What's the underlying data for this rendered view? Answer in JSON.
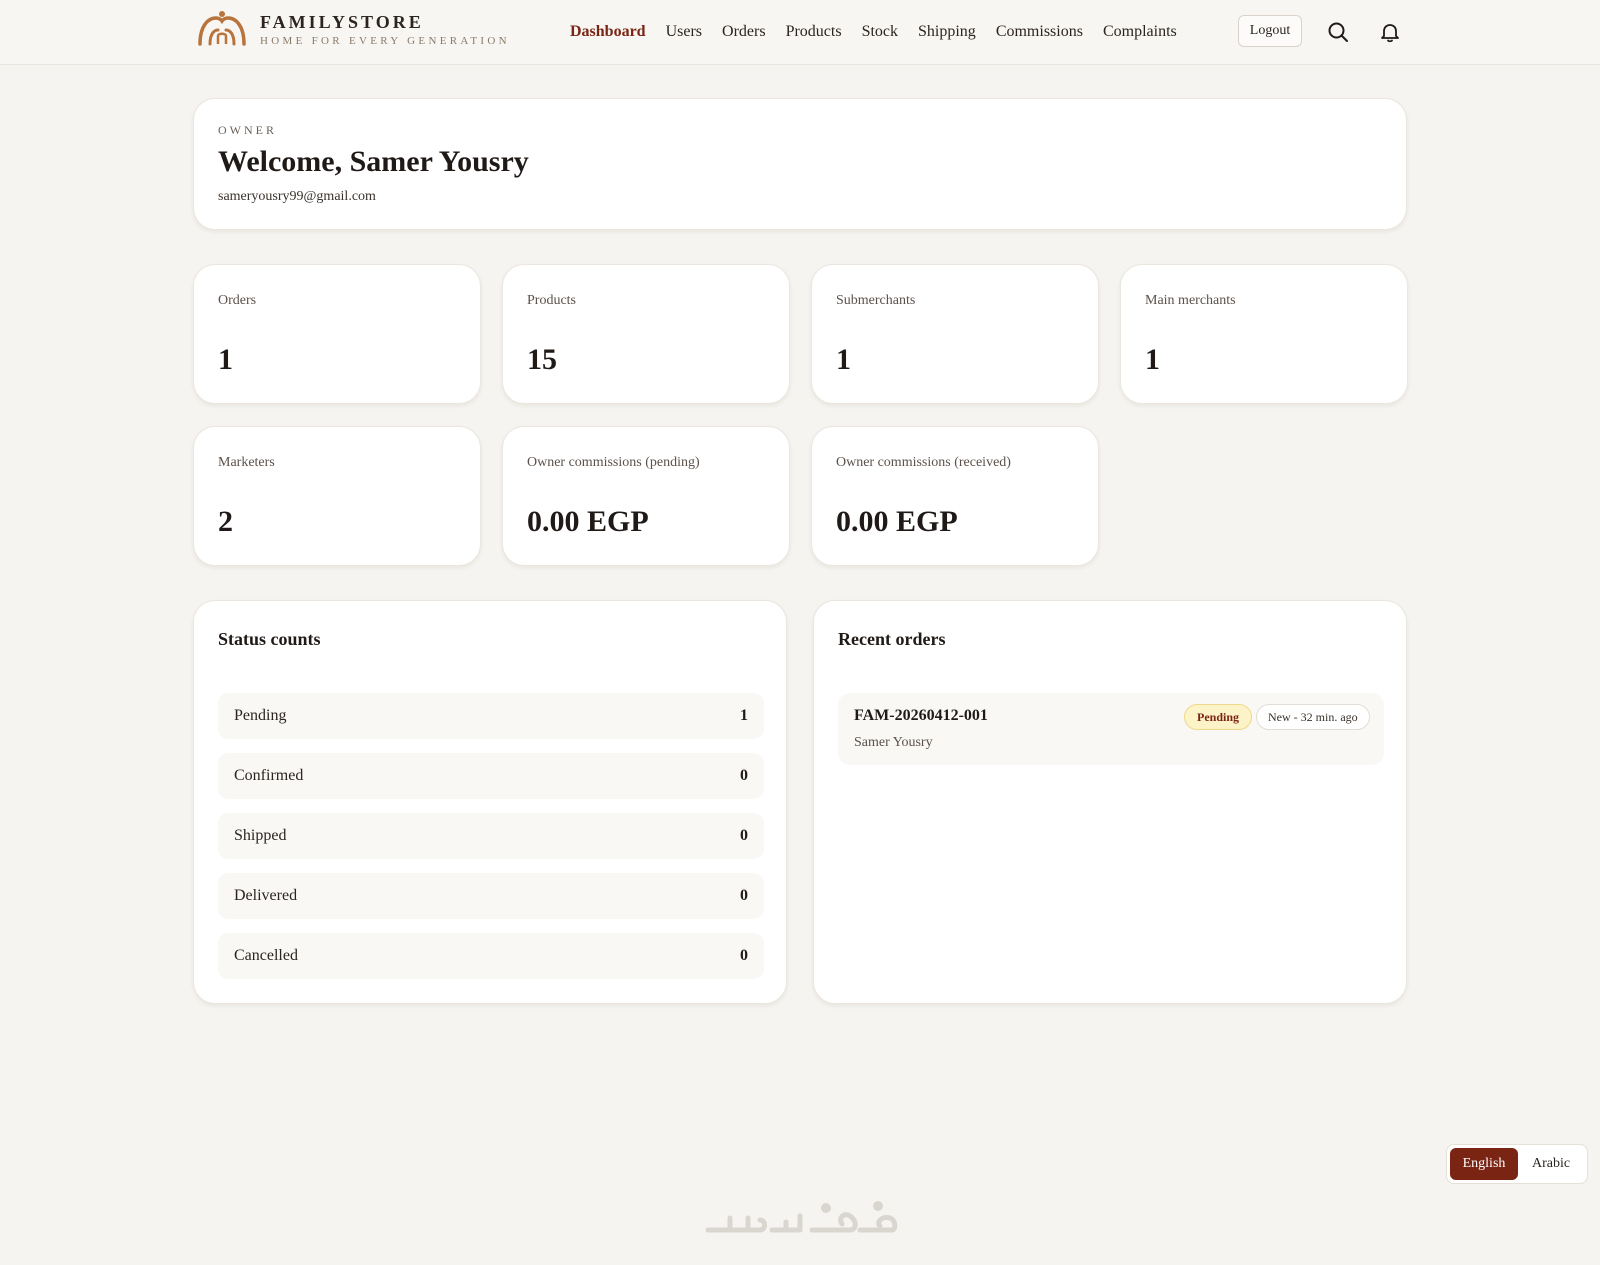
{
  "brand": {
    "name": "FAMILYSTORE",
    "tagline": "HOME FOR EVERY GENERATION",
    "logo_icon": "arch-logo-icon",
    "accent": "#7a2414"
  },
  "nav": {
    "items": [
      {
        "label": "Dashboard",
        "active": true
      },
      {
        "label": "Users"
      },
      {
        "label": "Orders"
      },
      {
        "label": "Products"
      },
      {
        "label": "Stock"
      },
      {
        "label": "Shipping"
      },
      {
        "label": "Commissions"
      },
      {
        "label": "Complaints"
      }
    ],
    "logout_label": "Logout",
    "search_icon": "search-icon",
    "bell_icon": "bell-icon"
  },
  "welcome": {
    "role": "OWNER",
    "title": "Welcome, Samer Yousry",
    "email": "sameryousry99@gmail.com"
  },
  "stats": [
    {
      "label": "Orders",
      "value": "1"
    },
    {
      "label": "Products",
      "value": "15"
    },
    {
      "label": "Submerchants",
      "value": "1"
    },
    {
      "label": "Main merchants",
      "value": "1"
    },
    {
      "label": "Marketers",
      "value": "2"
    },
    {
      "label": "Owner commissions (pending)",
      "value": "0.00 EGP"
    },
    {
      "label": "Owner commissions (received)",
      "value": "0.00 EGP"
    }
  ],
  "status_counts": {
    "title": "Status counts",
    "rows": [
      {
        "label": "Pending",
        "count": "1"
      },
      {
        "label": "Confirmed",
        "count": "0"
      },
      {
        "label": "Shipped",
        "count": "0"
      },
      {
        "label": "Delivered",
        "count": "0"
      },
      {
        "label": "Cancelled",
        "count": "0"
      }
    ]
  },
  "recent_orders": {
    "title": "Recent orders",
    "orders": [
      {
        "id": "FAM-20260412-001",
        "customer": "Samer Yousry",
        "status": "Pending",
        "time": "New - 32 min. ago"
      }
    ]
  },
  "language": {
    "english": "English",
    "arabic": "Arabic",
    "selected": "English"
  }
}
